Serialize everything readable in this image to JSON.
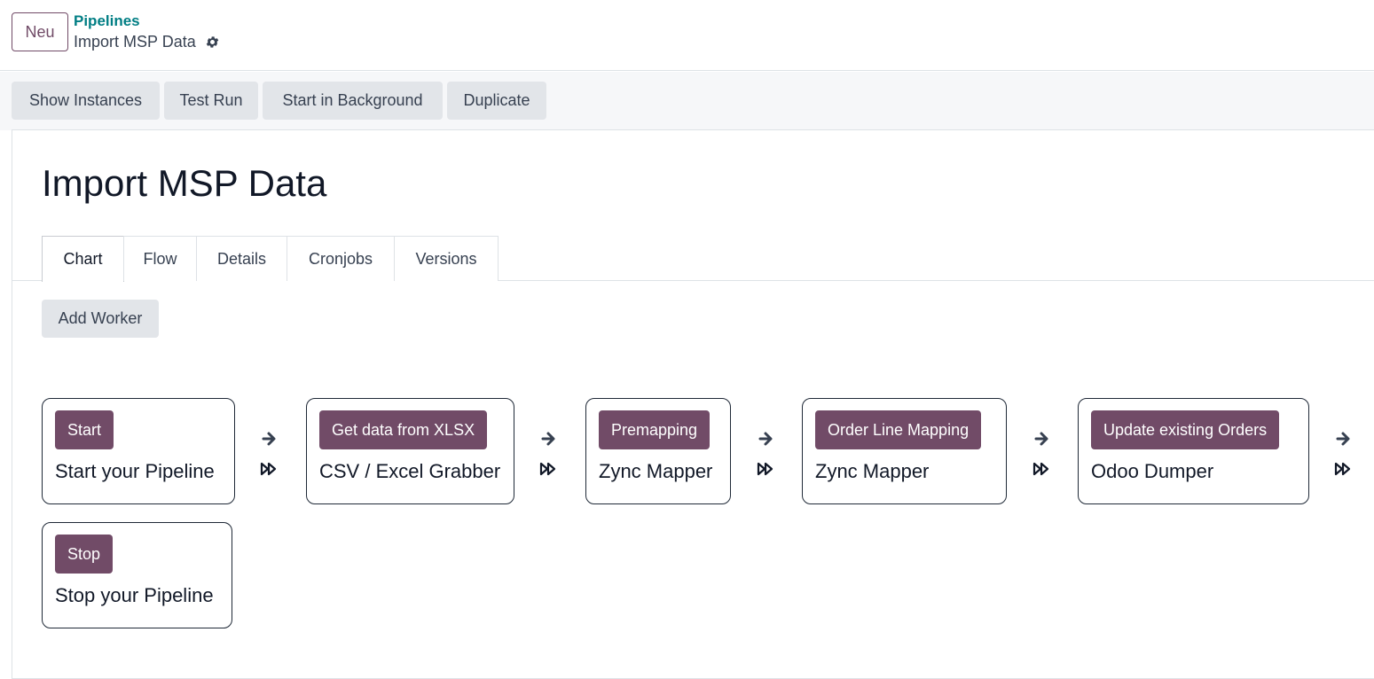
{
  "header": {
    "new_button": "Neu",
    "breadcrumb_parent": "Pipelines",
    "breadcrumb_current": "Import MSP Data"
  },
  "actions": [
    "Show Instances",
    "Test Run",
    "Start in Background",
    "Duplicate"
  ],
  "record": {
    "title": "Import MSP Data"
  },
  "tabs": [
    "Chart",
    "Flow",
    "Details",
    "Cronjobs",
    "Versions"
  ],
  "active_tab": "Chart",
  "add_worker_label": "Add Worker",
  "workers": [
    {
      "badge": "Start",
      "name": "Start your Pipeline"
    },
    {
      "badge": "Get data from XLSX",
      "name": "CSV / Excel Grabber"
    },
    {
      "badge": "Premapping",
      "name": "Zync Mapper"
    },
    {
      "badge": "Order Line Mapping",
      "name": "Zync Mapper"
    },
    {
      "badge": "Update existing Orders",
      "name": "Odoo Dumper"
    },
    {
      "badge": "Stop",
      "name": "Stop your Pipeline"
    }
  ],
  "colors": {
    "primary": "#714b67",
    "link": "#017e84"
  },
  "icons": {
    "settings": "gear-icon",
    "next": "arrow-right-icon",
    "skip": "fast-forward-icon"
  }
}
